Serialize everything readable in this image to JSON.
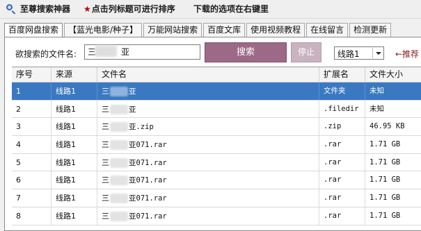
{
  "menubar": {
    "title": "至尊搜索神器",
    "sort_hint": "点击列标题可进行排序",
    "download_hint": "下载的选项在右键里"
  },
  "tabs": [
    {
      "label": "百度网盘搜索",
      "active": true
    },
    {
      "label": "【蓝光电影/种子】"
    },
    {
      "label": "万能网站搜索"
    },
    {
      "label": "百度文库"
    },
    {
      "label": "使用视频教程"
    },
    {
      "label": "在线留言"
    },
    {
      "label": "检测更新"
    }
  ],
  "search": {
    "label": "欲搜索的文件名:",
    "value_prefix": "三",
    "value_suffix": "亚",
    "search_button": "搜索",
    "stop_button": "停止",
    "route_selected": "线路1",
    "recommend_hint": "←推荐"
  },
  "table": {
    "columns": [
      "序号",
      "来源",
      "文件名",
      "扩展名",
      "文件大小"
    ],
    "rows": [
      {
        "no": "1",
        "src": "线路1",
        "pre": "三",
        "post": "亚",
        "ext": "文件夹",
        "size": "未知",
        "selected": true
      },
      {
        "no": "2",
        "src": "线路1",
        "pre": "三",
        "post": "亚",
        "ext": ".filedir",
        "size": "未知"
      },
      {
        "no": "3",
        "src": "线路1",
        "pre": "三",
        "post": "亚.zip",
        "ext": ".zip",
        "size": "46.95 KB"
      },
      {
        "no": "4",
        "src": "线路1",
        "pre": "三",
        "post": "亚071.rar",
        "ext": ".rar",
        "size": "1.71 GB"
      },
      {
        "no": "5",
        "src": "线路1",
        "pre": "三",
        "post": "亚071.rar",
        "ext": ".rar",
        "size": "1.71 GB"
      },
      {
        "no": "6",
        "src": "线路1",
        "pre": "三",
        "post": "亚071.rar",
        "ext": ".rar",
        "size": "1.71 GB"
      },
      {
        "no": "7",
        "src": "线路1",
        "pre": "三",
        "post": "亚071.rar",
        "ext": ".rar",
        "size": "1.71 GB"
      },
      {
        "no": "8",
        "src": "线路1",
        "pre": "三",
        "post": "亚071.rar",
        "ext": ".rar",
        "size": "1.71 GB"
      }
    ]
  }
}
